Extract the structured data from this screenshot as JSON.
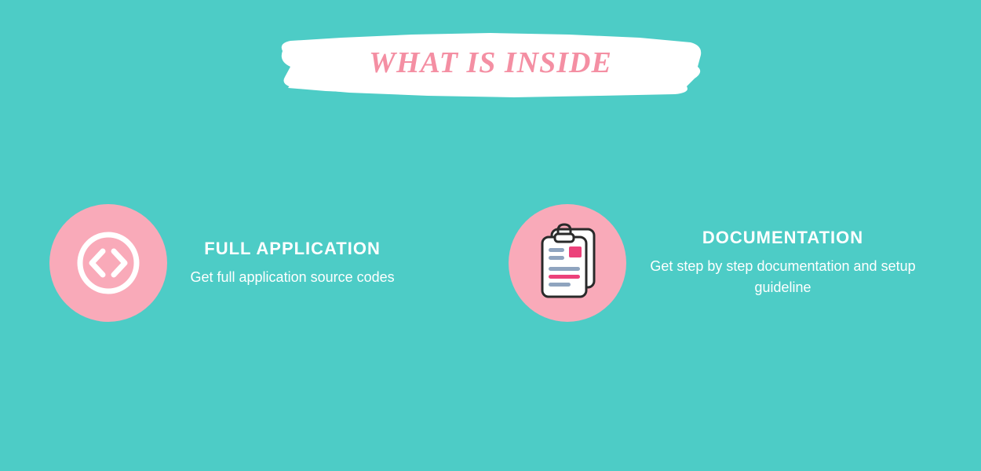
{
  "header": {
    "title": "What is inside"
  },
  "features": [
    {
      "icon": "code-circle",
      "title": "FULL APPLICATION",
      "description": "Get full application source codes"
    },
    {
      "icon": "clipboard-document",
      "title": "DOCUMENTATION",
      "description": "Get step by step documentation and setup guideline"
    }
  ],
  "colors": {
    "background": "#4dccc6",
    "accent_pink": "#f9aab9",
    "title_pink": "#f48fa3",
    "hot_pink": "#ec417a",
    "text": "#ffffff"
  }
}
